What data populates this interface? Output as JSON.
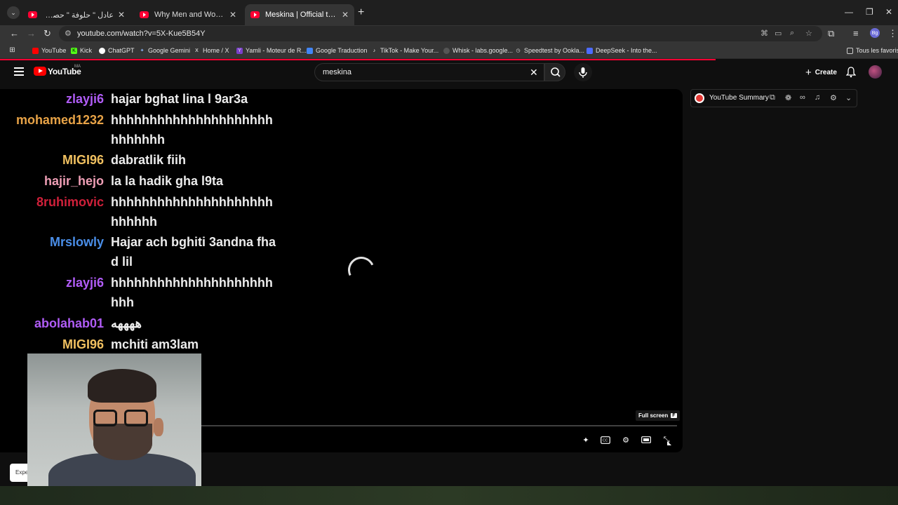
{
  "browser": {
    "tabs": [
      {
        "title": "عادل \" حلوفة \" حصري-فيديو كليب",
        "active": false
      },
      {
        "title": "Why Men and Women Cant be",
        "active": false
      },
      {
        "title": "Meskina | Official trailer | Netflix",
        "active": true
      }
    ],
    "url": "youtube.com/watch?v=5X-Kue5B54Y",
    "profile_initials": "Bg",
    "bookmarks": [
      "YouTube",
      "Kick",
      "ChatGPT",
      "Google Gemini",
      "Home / X",
      "Yamli - Moteur de R...",
      "Google Traduction",
      "TikTok - Make Your...",
      "Whisk - labs.google...",
      "Speedtest by Ookla...",
      "DeepSeek - Into the..."
    ],
    "all_bookmarks_label": "Tous les favoris"
  },
  "youtube": {
    "logo_text": "YouTube",
    "country_code": "MA",
    "search_value": "meskina",
    "create_label": "Create"
  },
  "chat": [
    {
      "user": "zlayji6",
      "color": "#b05cf6",
      "text": "hajar bghat lina l 9ar3a"
    },
    {
      "user": "mohamed1232",
      "color": "#e8a347",
      "text": "hhhhhhhhhhhhhhhhhhhhhhhhhhhh"
    },
    {
      "user": "MIGI96",
      "color": "#f0c060",
      "text": "dabratlik fiih"
    },
    {
      "user": "hajir_hejo",
      "color": "#ef9fb6",
      "text": "la la hadik gha l9ta"
    },
    {
      "user": "8ruhimovic",
      "color": "#d0203a",
      "text": "hhhhhhhhhhhhhhhhhhhhhhhhhhh"
    },
    {
      "user": "Mrslowly",
      "color": "#4a8ee8",
      "text": "Hajar ach bghiti 3andna fhad lil"
    },
    {
      "user": "zlayji6",
      "color": "#b05cf6",
      "text": "hhhhhhhhhhhhhhhhhhhhhhhh"
    },
    {
      "user": "abolahab01",
      "color": "#b05cf6",
      "text": "ههههه"
    },
    {
      "user": "MIGI96",
      "color": "#f0c060",
      "text": "mchiti am3lam"
    }
  ],
  "player": {
    "tooltip": "Full screen",
    "tooltip_key": "F"
  },
  "summary_ext": {
    "title": "YouTube Summary"
  },
  "partial_button": "Expe"
}
